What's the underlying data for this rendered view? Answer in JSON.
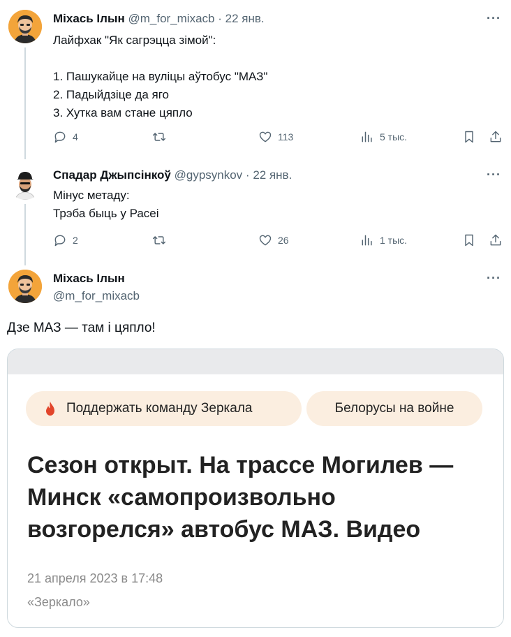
{
  "tweet1": {
    "name": "Міхась Ілын",
    "handle": "@m_for_mixacb",
    "separator": "·",
    "date": "22 янв.",
    "text": "Лайфхак \"Як сагрэцца зімой\":\n\n1. Пашукайце на вуліцы аўтобус \"МАЗ\"\n2. Падыйдзіце да яго\n3. Хутка вам стане цяпло",
    "replies": "4",
    "likes": "113",
    "views": "5 тыс.",
    "more": "···"
  },
  "tweet2": {
    "name": "Спадар Джыпсінкоў",
    "handle": "@gypsynkov",
    "separator": "·",
    "date": "22 янв.",
    "text": "Мінус метаду:\nТрэба быць у Расеі",
    "replies": "2",
    "likes": "26",
    "views": "1 тыс.",
    "more": "···"
  },
  "tweet3": {
    "name": "Міхась Ілын",
    "handle": "@m_for_mixacb",
    "text": "Дзе МАЗ — там і цяпло!",
    "more": "···"
  },
  "card": {
    "button_support": "Поддержать команду Зеркала",
    "button_war": "Белорусы на войне",
    "headline": "Сезон открыт. На трассе Могилев — Минск «самопроизвольно возгорелся» автобус МАЗ. Видео",
    "date": "21 апреля 2023 в 17:48",
    "source": "«Зеркало»"
  },
  "colors": {
    "text": "#0f1419",
    "secondary": "#536471",
    "thread_line": "#cfd9de",
    "pill_bg": "#fbeee0",
    "flame": "#e2452b"
  },
  "icons": [
    "reply-icon",
    "retweet-icon",
    "like-icon",
    "views-icon",
    "bookmark-icon",
    "share-icon",
    "flame-icon"
  ]
}
